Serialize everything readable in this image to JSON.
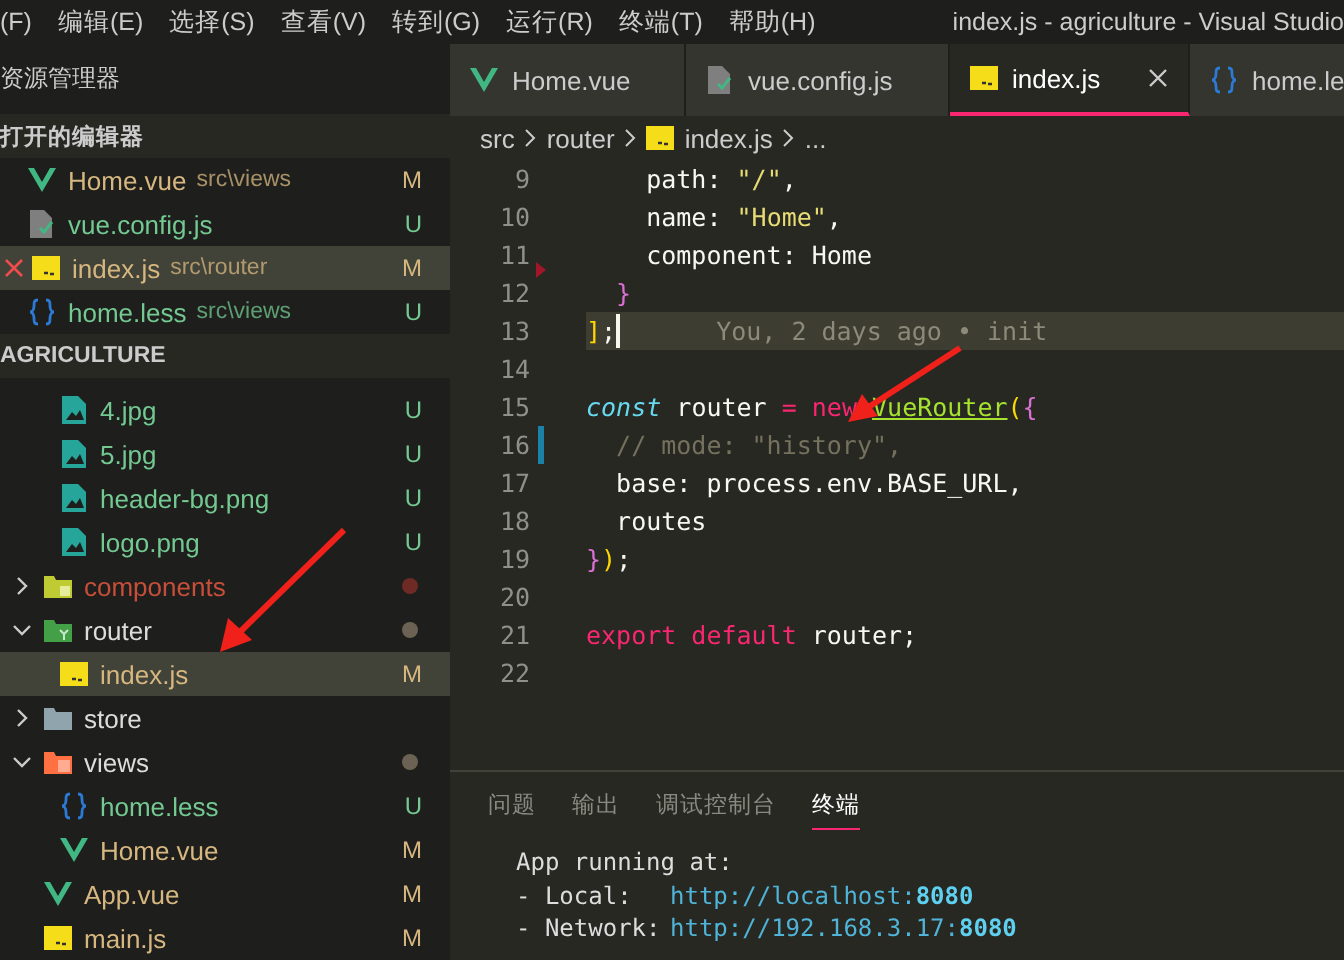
{
  "menu_bar": {
    "items": [
      "(F)",
      "编辑(E)",
      "选择(S)",
      "查看(V)",
      "转到(G)",
      "运行(R)",
      "终端(T)",
      "帮助(H)"
    ],
    "title": "index.js - agriculture - Visual Studio"
  },
  "sidebar": {
    "title": "资源管理器",
    "open_editors": {
      "title": "打开的编辑器",
      "items": [
        {
          "name": "Home.vue",
          "path": "src\\views",
          "kind": "vue",
          "status": "M",
          "selected": false
        },
        {
          "name": "vue.config.js",
          "kind": "config",
          "status": "U",
          "selected": false
        },
        {
          "name": "index.js",
          "path": "src\\router",
          "kind": "js",
          "status": "M",
          "selected": true
        },
        {
          "name": "home.less",
          "path": "src\\views",
          "kind": "less",
          "status": "U",
          "selected": false
        }
      ]
    },
    "project": {
      "title": "AGRICULTURE",
      "items": [
        {
          "children": [
            {
              "name": "4.jpg",
              "kind": "image",
              "status": "U",
              "selected": false
            },
            {
              "name": "5.jpg",
              "kind": "image",
              "status": "U",
              "selected": false
            },
            {
              "name": "header-bg.png",
              "kind": "image",
              "status": "U",
              "selected": false
            },
            {
              "name": "logo.png",
              "kind": "image",
              "status": "U",
              "selected": false
            }
          ]
        },
        {
          "name": "components",
          "kind": "folder-components",
          "expanded": false,
          "problem": true,
          "color": "#6e2a25",
          "selected": false
        },
        {
          "name": "router",
          "kind": "folder-router",
          "expanded": true,
          "problem": false,
          "color": "#6b6254",
          "selected": false,
          "children": [
            {
              "name": "index.js",
              "kind": "js",
              "status": "M",
              "selected": true
            }
          ]
        },
        {
          "name": "store",
          "kind": "folder-store",
          "expanded": false,
          "problem": false,
          "selected": false
        },
        {
          "name": "views",
          "kind": "folder-views",
          "expanded": true,
          "problem": false,
          "color": "#6b6254",
          "selected": false,
          "children": [
            {
              "name": "home.less",
              "kind": "less",
              "status": "U",
              "selected": false
            },
            {
              "name": "Home.vue",
              "kind": "vue",
              "status": "M",
              "selected": false
            }
          ]
        },
        {
          "name": "App.vue",
          "kind": "vue",
          "status": "M",
          "selected": false
        },
        {
          "name": "main.js",
          "kind": "js",
          "status": "M",
          "selected": false
        }
      ]
    }
  },
  "tabs": [
    {
      "label": "Home.vue",
      "kind": "vue",
      "selected": false
    },
    {
      "label": "vue.config.js",
      "kind": "config",
      "selected": false
    },
    {
      "label": "index.js",
      "kind": "js",
      "selected": true
    },
    {
      "label": "home.le",
      "kind": "less",
      "selected": false
    }
  ],
  "breadcrumb": [
    "src",
    "router",
    "index.js",
    "..."
  ],
  "code": [
    {
      "number": "9",
      "kind": "normal",
      "tokens": [
        {
          "t": "    path: ",
          "kind": "plain"
        },
        {
          "t": "\"/\"",
          "kind": "string"
        },
        {
          "t": ",",
          "kind": "plain"
        }
      ]
    },
    {
      "number": "10",
      "kind": "normal",
      "tokens": [
        {
          "t": "    name: ",
          "kind": "plain"
        },
        {
          "t": "\"Home\"",
          "kind": "string"
        },
        {
          "t": ",",
          "kind": "plain"
        }
      ]
    },
    {
      "number": "11",
      "kind": "deleted",
      "tokens": [
        {
          "t": "    component: Home",
          "kind": "plain"
        }
      ]
    },
    {
      "number": "12",
      "kind": "normal",
      "tokens": [
        {
          "t": "  }",
          "kind": "bracket2"
        }
      ]
    },
    {
      "number": "13",
      "kind": "normal",
      "current": true,
      "blame": "You, 2 days ago • init",
      "tokens": [
        {
          "t": "]",
          "kind": "bracket1"
        },
        {
          "t": ";",
          "kind": "plain"
        }
      ]
    },
    {
      "number": "14",
      "kind": "normal"
    },
    {
      "number": "15",
      "kind": "normal",
      "tokens": [
        {
          "t": "const",
          "kind": "storage"
        },
        {
          "t": " router ",
          "kind": "plain"
        },
        {
          "t": "= new ",
          "kind": "keyword"
        },
        {
          "t": "VueRouter",
          "kind": "class"
        },
        {
          "t": "(",
          "kind": "bracket1"
        },
        {
          "t": "{",
          "kind": "bracket2"
        }
      ]
    },
    {
      "number": "16",
      "kind": "modified",
      "tokens": [
        {
          "t": "  // mode: \"history\",",
          "kind": "comment"
        }
      ]
    },
    {
      "number": "17",
      "kind": "normal",
      "tokens": [
        {
          "t": "  base: process.env.BASE_URL,",
          "kind": "plain"
        }
      ]
    },
    {
      "number": "18",
      "kind": "normal",
      "tokens": [
        {
          "t": "  routes",
          "kind": "plain"
        }
      ]
    },
    {
      "number": "19",
      "kind": "normal",
      "tokens": [
        {
          "t": "}",
          "kind": "bracket2"
        },
        {
          "t": ")",
          "kind": "bracket1"
        },
        {
          "t": ";",
          "kind": "plain"
        }
      ]
    },
    {
      "number": "20",
      "kind": "normal"
    },
    {
      "number": "21",
      "kind": "normal",
      "tokens": [
        {
          "t": "export default",
          "kind": "keyword"
        },
        {
          "t": " router;",
          "kind": "plain"
        }
      ]
    },
    {
      "number": "22",
      "kind": "normal"
    }
  ],
  "panel": {
    "tabs": [
      {
        "label": "问题",
        "selected": false
      },
      {
        "label": "输出",
        "selected": false
      },
      {
        "label": "调试控制台",
        "selected": false
      },
      {
        "label": "终端",
        "selected": true
      }
    ],
    "terminal": {
      "heading": "App running at:",
      "entries": [
        {
          "label": "- Local:",
          "url": "http://localhost:",
          "port": "8080"
        },
        {
          "label": "- Network:",
          "url": "http://192.168.3.17:",
          "port": "8080"
        }
      ]
    }
  }
}
